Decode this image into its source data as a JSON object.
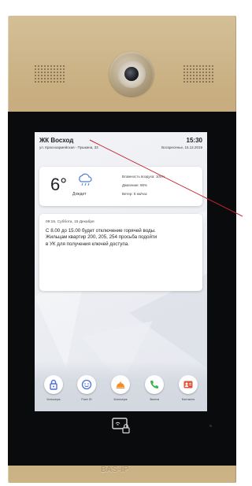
{
  "screen": {
    "title": "ЖК Восход",
    "address": "ул. Красноармейская - Пушкина, 33",
    "time": "15:30",
    "date": "Воскресенье, 15.12.2019"
  },
  "weather": {
    "temperature": "6°",
    "condition": "Дождит",
    "humidity_label": "Влажность воздуха: 100%",
    "pressure_label": "Давление: 86%",
    "wind_label": "Ветер: 5 км/час"
  },
  "notice": {
    "date": "09:15, Суббота, 15 Декабря",
    "lines": [
      "С 8.00 до 15.00 будет отключение горячей воды.",
      "Жильцам квартир 200, 205, 254 просьба подойти",
      "в УК для получения ключей доступа."
    ]
  },
  "apps": [
    {
      "label": "Консьерж",
      "icon": "lock-icon",
      "color": "#4a6fe0"
    },
    {
      "label": "Face ID",
      "icon": "face-icon",
      "color": "#4a6fe0"
    },
    {
      "label": "Консьерж",
      "icon": "bell-icon",
      "color": "#f28c28"
    },
    {
      "label": "Звонок",
      "icon": "phone-icon",
      "color": "#3cb44b"
    },
    {
      "label": "Контакты",
      "icon": "contacts-icon",
      "color": "#e5533d"
    }
  ],
  "brand": "BAS-IP",
  "colors": {
    "bezel": "#c7ad7f",
    "panel": "#0a0b0d",
    "cable": "#c0242b"
  }
}
